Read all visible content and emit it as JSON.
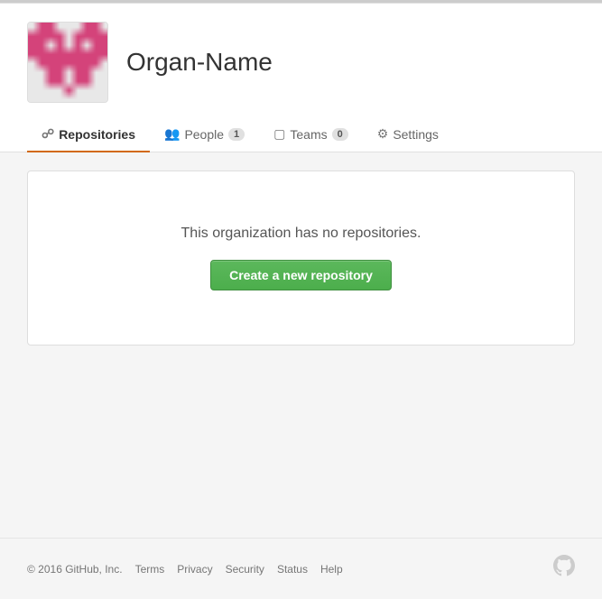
{
  "top_border": {},
  "header": {
    "org_name": "Organ-Name",
    "avatar_alt": "Organization avatar"
  },
  "nav": {
    "tabs": [
      {
        "id": "repositories",
        "label": "Repositories",
        "icon": "repo-icon",
        "badge": null,
        "active": true
      },
      {
        "id": "people",
        "label": "People",
        "icon": "people-icon",
        "badge": "1",
        "active": false
      },
      {
        "id": "teams",
        "label": "Teams",
        "icon": "teams-icon",
        "badge": "0",
        "active": false
      },
      {
        "id": "settings",
        "label": "Settings",
        "icon": "settings-icon",
        "badge": null,
        "active": false
      }
    ]
  },
  "main": {
    "empty_message": "This organization has no repositories.",
    "create_button_label": "Create a new repository"
  },
  "footer": {
    "copyright": "© 2016 GitHub, Inc.",
    "links": [
      {
        "label": "Terms"
      },
      {
        "label": "Privacy"
      },
      {
        "label": "Security"
      },
      {
        "label": "Status"
      },
      {
        "label": "Help"
      }
    ]
  }
}
